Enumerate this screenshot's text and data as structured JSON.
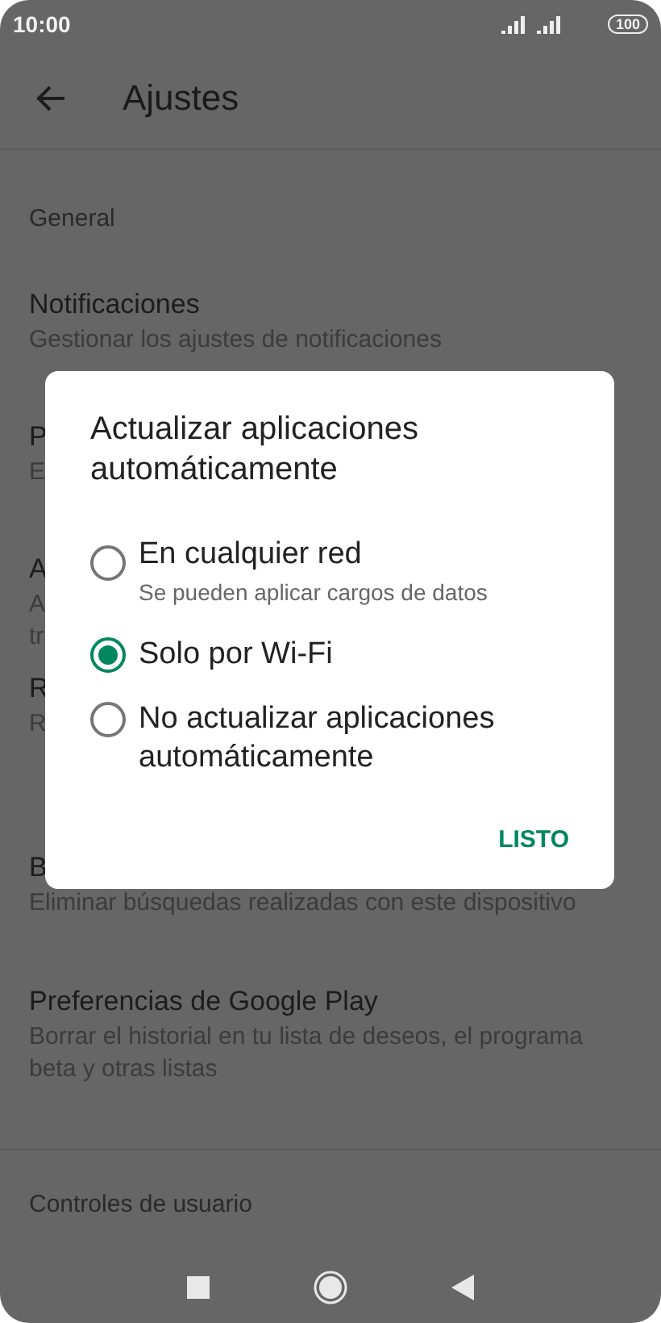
{
  "status_bar": {
    "time": "10:00",
    "battery": "100"
  },
  "app_bar": {
    "title": "Ajustes"
  },
  "sections": [
    {
      "kind": "header",
      "title": "General"
    },
    {
      "kind": "item",
      "title": "Notificaciones",
      "subtitle": [
        "Gestionar los ajustes de notificaciones"
      ]
    },
    {
      "kind": "item",
      "title": "P",
      "subtitle": [
        "E"
      ]
    },
    {
      "kind": "item",
      "title": "A",
      "subtitle": [
        "A",
        "tr"
      ]
    },
    {
      "kind": "item",
      "title": "R",
      "subtitle": [
        "R"
      ]
    },
    {
      "kind": "item",
      "title": "B",
      "subtitle": [
        "Eliminar búsquedas realizadas con este dispositivo"
      ]
    },
    {
      "kind": "item",
      "title": "Preferencias de Google Play",
      "subtitle": [
        "Borrar el historial en tu lista de deseos, el programa beta y otras listas"
      ]
    },
    {
      "kind": "divider"
    },
    {
      "kind": "header",
      "title": "Controles de usuario"
    }
  ],
  "dialog": {
    "title": "Actualizar aplicaciones automáticamente",
    "options": [
      {
        "label": "En cualquier red",
        "hint": "Se pueden aplicar cargos de datos",
        "selected": false
      },
      {
        "label": "Solo por Wi-Fi",
        "selected": true
      },
      {
        "label": "No actualizar aplicaciones automáticamente",
        "selected": false
      }
    ],
    "button": "LISTO"
  }
}
